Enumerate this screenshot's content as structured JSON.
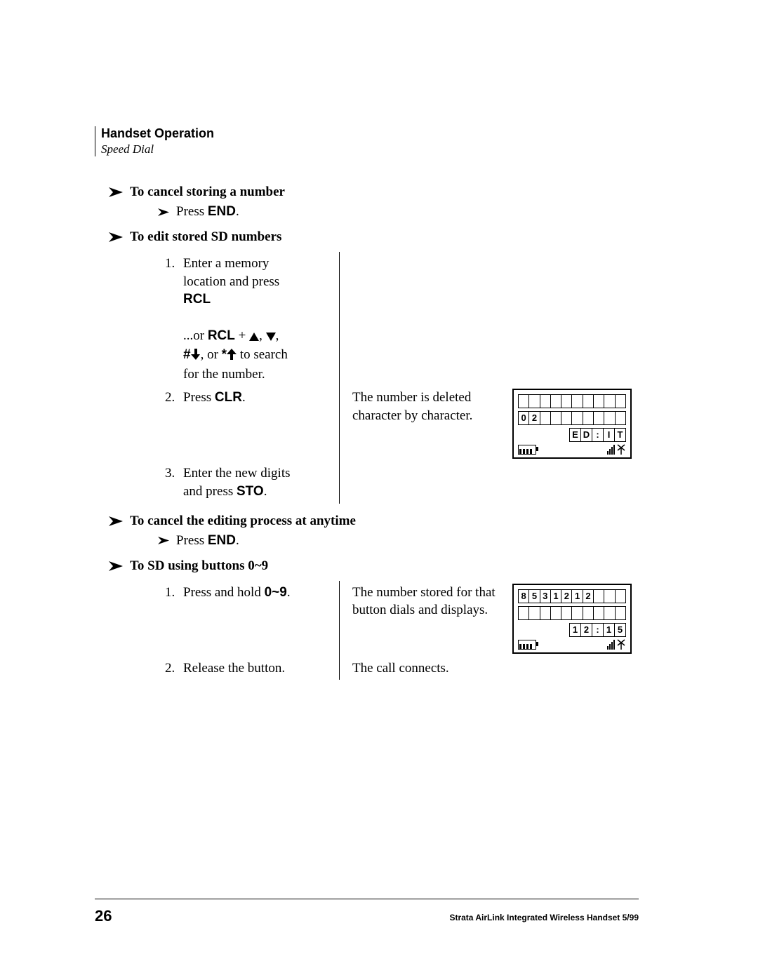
{
  "header": {
    "title": "Handset Operation",
    "subtitle": "Speed Dial"
  },
  "sections": {
    "cancel_store": {
      "title": "To cancel storing a number",
      "step_prefix": "Press ",
      "step_key": "END",
      "step_suffix": "."
    },
    "edit": {
      "title": "To edit stored SD numbers",
      "s1_num": "1.",
      "s1_line1": "Enter a memory",
      "s1_line2": "location and press",
      "s1_key": "RCL",
      "s1b_prefix": "...or ",
      "s1b_key": "RCL",
      "s1b_mid1": " + ",
      "s1b_mid2": ", ",
      "s1b_mid3": ",",
      "s1c_hash": "#",
      "s1c_mid": ", or ",
      "s1c_star": "*",
      "s1c_tail1": " to search",
      "s1c_tail2": "for the number.",
      "s2_num": "2.",
      "s2_left_a": "Press ",
      "s2_left_key": "CLR",
      "s2_left_b": ".",
      "s2_mid1": "The number is deleted",
      "s2_mid2": "character by character.",
      "s3_num": "3.",
      "s3_line1": "Enter the new digits",
      "s3_line2a": "and press ",
      "s3_line2_key": "STO",
      "s3_line2b": "."
    },
    "cancel_edit": {
      "title": "To cancel the editing process at anytime",
      "step_prefix": "Press ",
      "step_key": "END",
      "step_suffix": "."
    },
    "sd09": {
      "title": "To SD using buttons 0~9",
      "s1_num": "1.",
      "s1_left_a": "Press and hold ",
      "s1_left_key": "0~9",
      "s1_left_b": ".",
      "s1_mid1": "The number stored for that",
      "s1_mid2": "button dials and displays.",
      "s2_num": "2.",
      "s2_left": "Release the button.",
      "s2_mid": "The call connects."
    }
  },
  "lcd1": {
    "row1": [
      "",
      "",
      "",
      "",
      "",
      "",
      "",
      "",
      "",
      ""
    ],
    "row2": [
      "0",
      "2",
      "",
      "",
      "",
      "",
      "",
      "",
      "",
      ""
    ],
    "row3": [
      "E",
      "D",
      ":",
      "I",
      "T"
    ]
  },
  "lcd2": {
    "row1": [
      "8",
      "5",
      "3",
      "1",
      "2",
      "1",
      "2",
      "",
      "",
      ""
    ],
    "row2": [
      "",
      "",
      "",
      "",
      "",
      "",
      "",
      "",
      "",
      ""
    ],
    "row3": [
      "1",
      "2",
      ":",
      "1",
      "5"
    ]
  },
  "footer": {
    "page": "26",
    "text": "Strata AirLink Integrated Wireless Handset   5/99"
  }
}
